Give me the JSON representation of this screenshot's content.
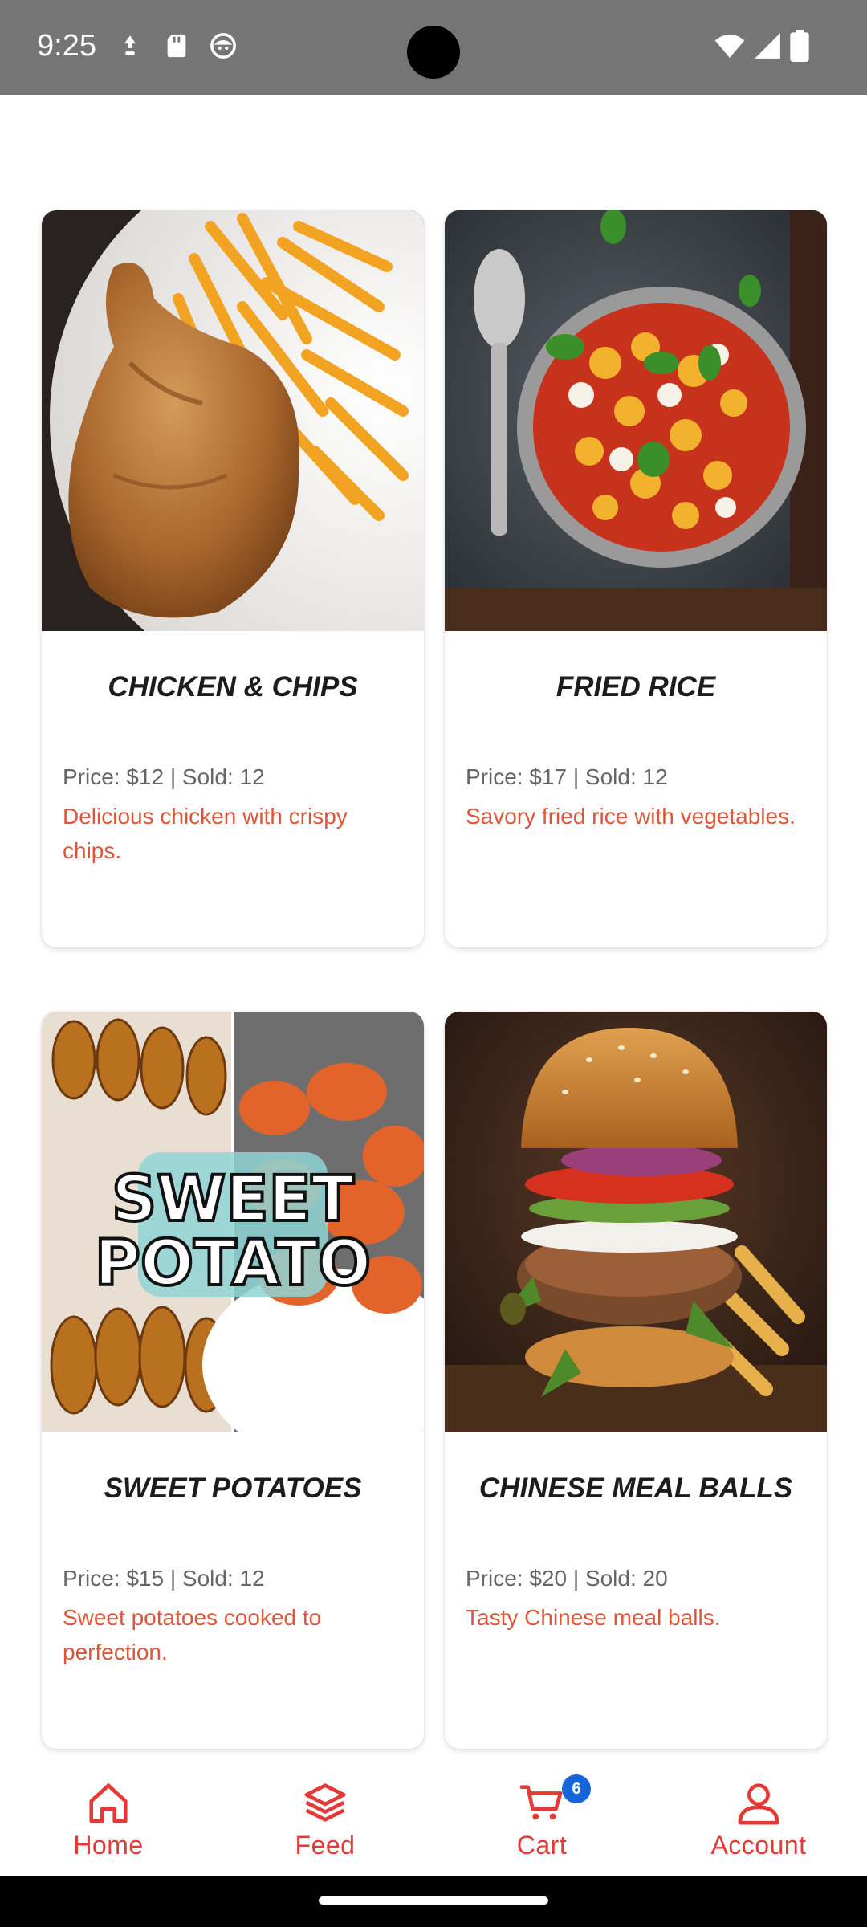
{
  "status_bar": {
    "time": "9:25",
    "icons": [
      "pin-icon",
      "sd-card-icon",
      "face-icon",
      "wifi-icon",
      "signal-icon",
      "battery-icon"
    ]
  },
  "products": [
    {
      "title": "CHICKEN & CHIPS",
      "price_line": "Price: $12 | Sold: 12",
      "description": "Delicious chicken with crispy chips.",
      "image": "chicken-and-chips-photo"
    },
    {
      "title": "FRIED RICE",
      "price_line": "Price: $17 | Sold: 12",
      "description": "Savory fried rice with vegetables.",
      "image": "gnocchi-pan-photo"
    },
    {
      "title": "SWEET POTATOES",
      "price_line": "Price: $15 | Sold: 12",
      "description": "Sweet potatoes cooked to perfection.",
      "image": "sweet-potato-photo",
      "image_text_line1": "SWEET",
      "image_text_line2": "POTATO"
    },
    {
      "title": "CHINESE MEAL BALLS",
      "price_line": "Price: $20 | Sold: 20",
      "description": "Tasty Chinese meal balls.",
      "image": "burger-photo"
    }
  ],
  "nav": {
    "home": "Home",
    "feed": "Feed",
    "cart": "Cart",
    "cart_badge": "6",
    "account": "Account"
  },
  "colors": {
    "accent": "#e53935",
    "description": "#e0553a",
    "badge": "#1565d8",
    "status_bar": "#757575"
  }
}
